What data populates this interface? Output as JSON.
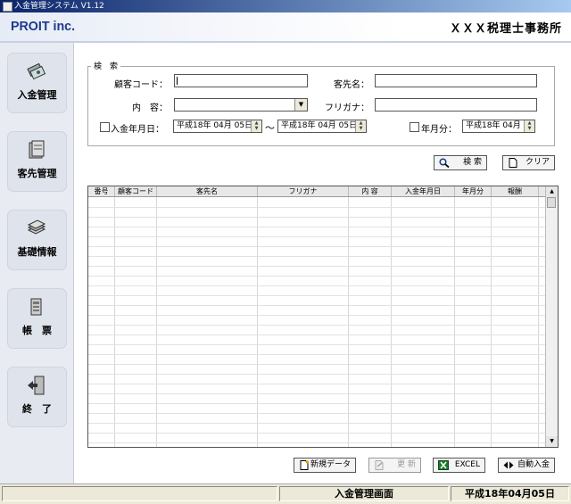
{
  "window": {
    "title": "入金管理システム V1.12"
  },
  "header": {
    "company_logo": "PROIT inc.",
    "office_name": "ＸＸＸ税理士事務所"
  },
  "sidebar": {
    "items": [
      {
        "label": "入金管理",
        "icon": "money-icon"
      },
      {
        "label": "客先管理",
        "icon": "address-book-icon"
      },
      {
        "label": "基礎情報",
        "icon": "stack-icon"
      },
      {
        "label": "帳　票",
        "icon": "report-icon"
      },
      {
        "label": "終　了",
        "icon": "exit-door-icon"
      }
    ]
  },
  "search": {
    "legend": "検　索",
    "client_code_label": "顧客コード：",
    "client_code_value": "",
    "customer_name_label": "客先名：",
    "customer_name_value": "",
    "content_label": "内　容：",
    "content_value": "",
    "furigana_label": "フリガナ：",
    "furigana_value": "",
    "payment_date_label": "入金年月日：",
    "payment_date_checked": false,
    "date_from": "平成18年 04月 05日",
    "range_separator": "～",
    "date_to": "平成18年 04月 05日",
    "month_label": "年月分：",
    "month_checked": false,
    "month_value": "平成18年 04月",
    "search_button": "検 索",
    "clear_button": "クリア"
  },
  "grid": {
    "columns": [
      "番号",
      "顧客コード",
      "客先名",
      "フリガナ",
      "内 容",
      "入金年月日",
      "年月分",
      "報酬"
    ],
    "rows": []
  },
  "actions": {
    "new_button": "新規データ",
    "update_button": "更 新",
    "excel_button": "EXCEL",
    "auto_button": "自動入金"
  },
  "status": {
    "screen_name": "入金管理画面",
    "date": "平成18年04月05日"
  }
}
